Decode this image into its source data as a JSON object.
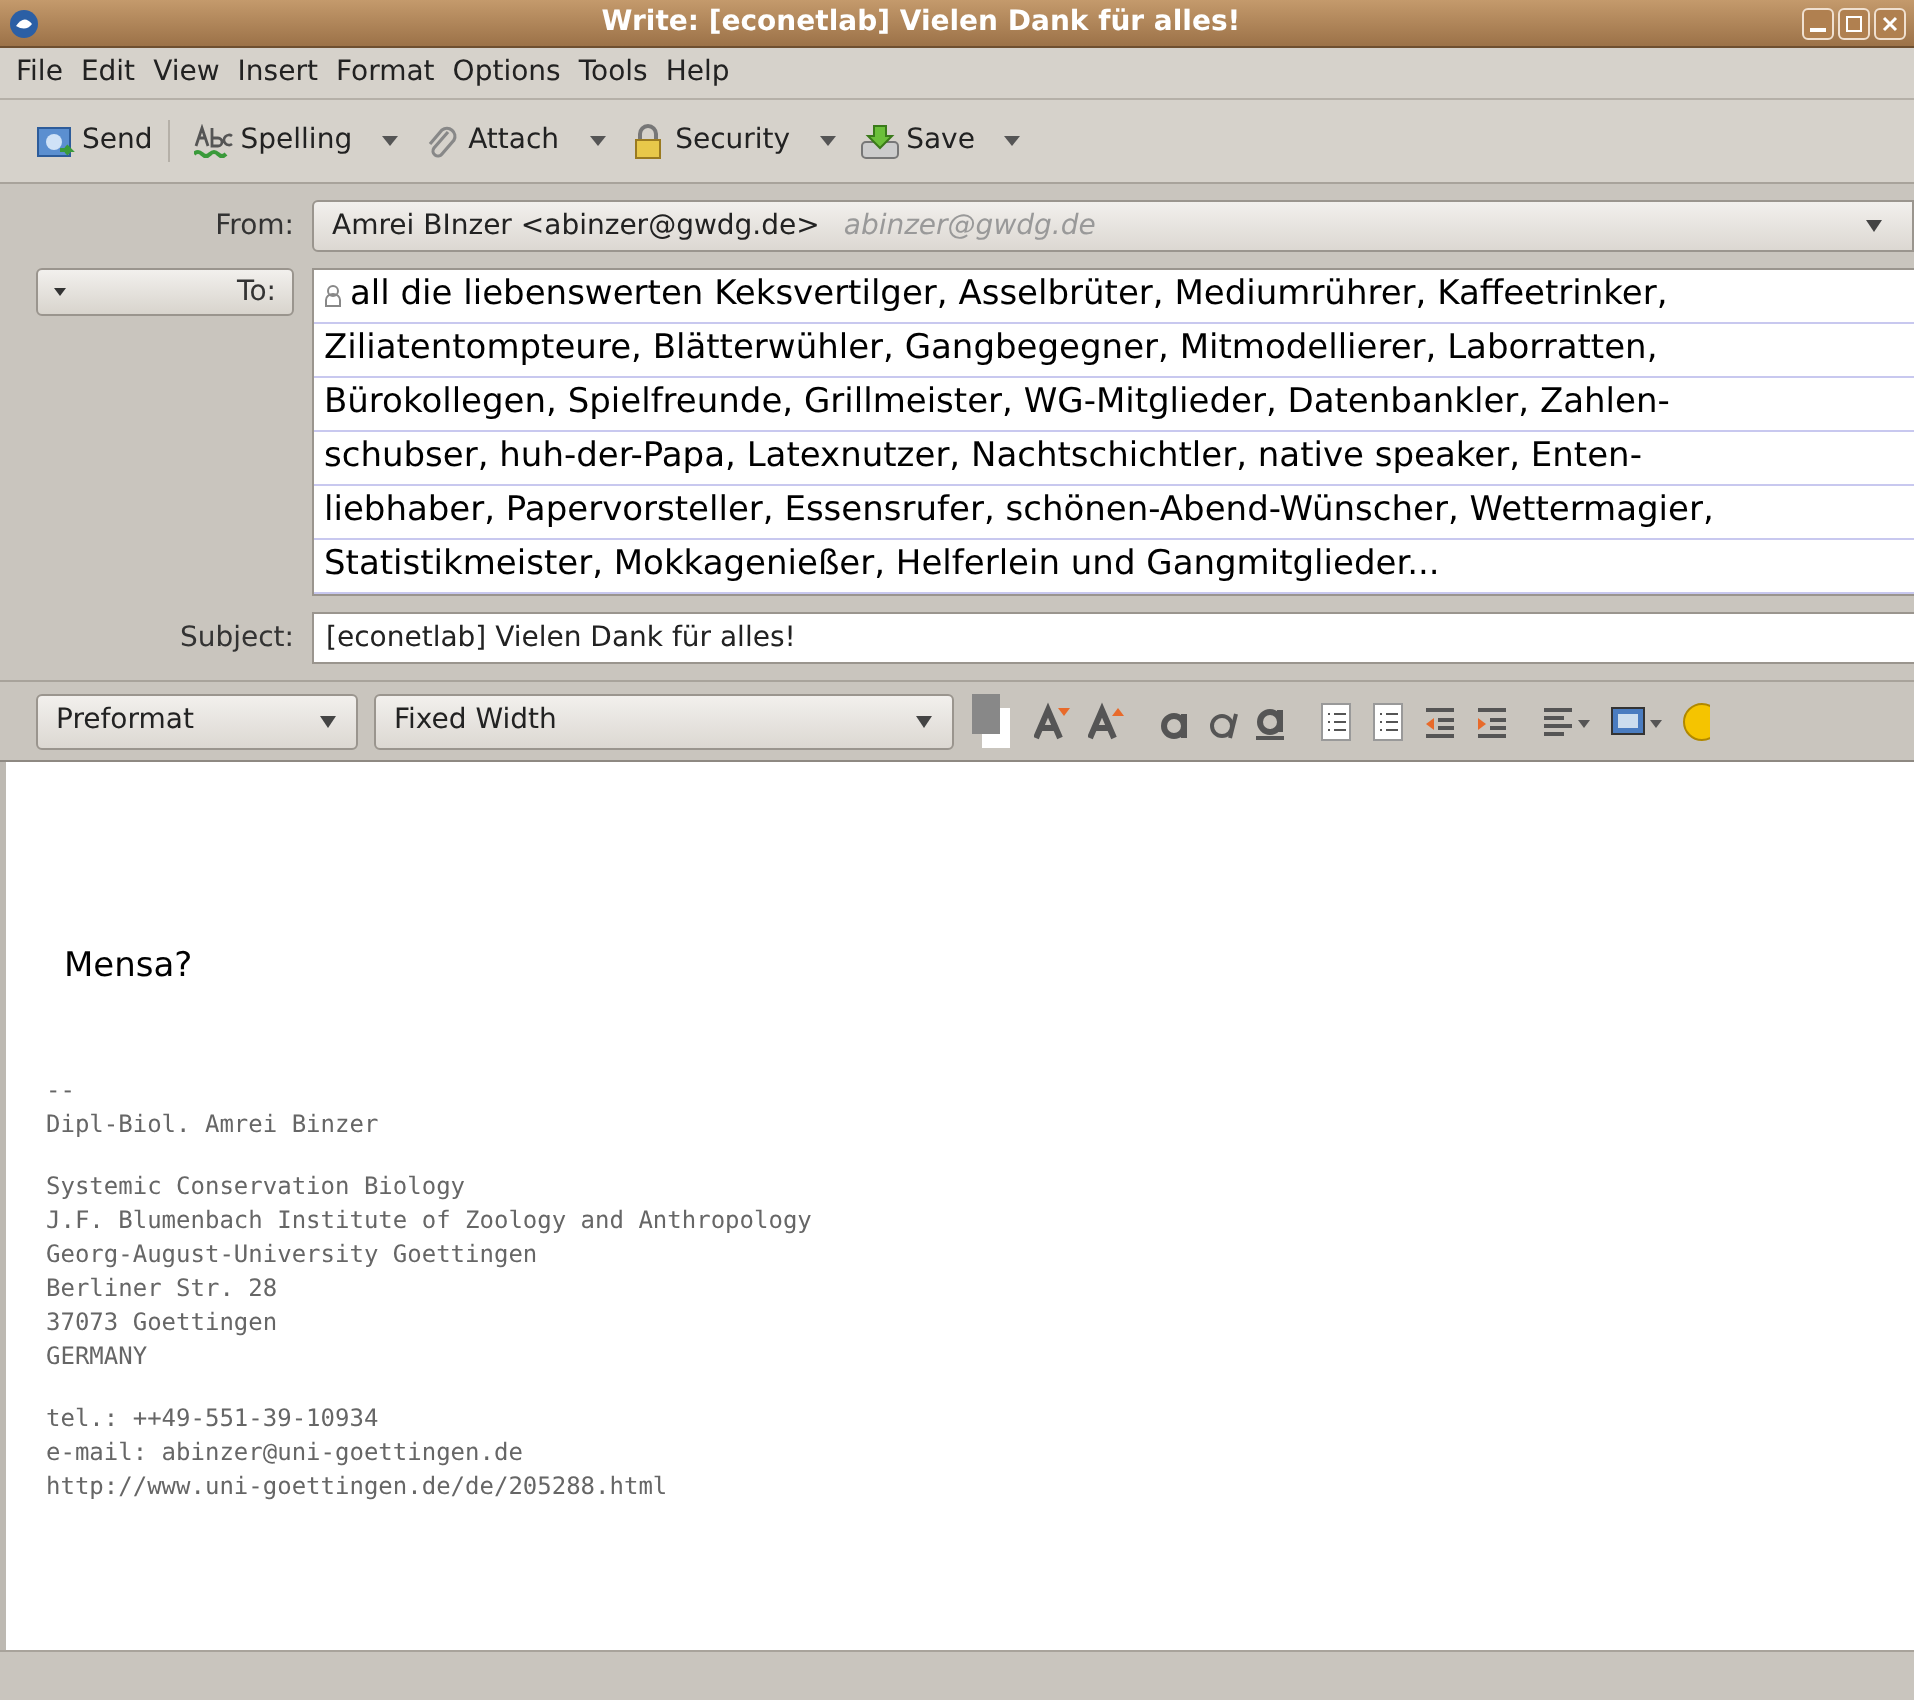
{
  "window": {
    "title": "Write: [econetlab] Vielen Dank für alles!"
  },
  "menu": [
    "File",
    "Edit",
    "View",
    "Insert",
    "Format",
    "Options",
    "Tools",
    "Help"
  ],
  "toolbar": [
    {
      "kind": "send",
      "label": "Send",
      "dropdown": false
    },
    {
      "kind": "spelling",
      "label": "Spelling",
      "dropdown": true
    },
    {
      "kind": "attach",
      "label": "Attach",
      "dropdown": true
    },
    {
      "kind": "security",
      "label": "Security",
      "dropdown": true
    },
    {
      "kind": "save",
      "label": "Save",
      "dropdown": true
    }
  ],
  "from": {
    "label": "From:",
    "name": "Amrei BInzer <abinzer@gwdg.de>",
    "account": "abinzer@gwdg.de"
  },
  "to": {
    "label": "To:",
    "lines": [
      "all die liebenswerten Keksvertilger, Asselbrüter, Mediumrührer, Kaffeetrinker,",
      "Ziliatentompteure, Blätterwühler, Gangbegegner, Mitmodellierer, Laborratten,",
      "Bürokollegen, Spielfreunde, Grillmeister, WG-Mitglieder, Datenbankler, Zahlen-",
      "schubser, huh-der-Papa, Latexnutzer, Nachtschichtler, native speaker, Enten-",
      "liebhaber, Papervorsteller, Essensrufer, schönen-Abend-Wünscher, Wettermagier,",
      "Statistikmeister, Mokkagenießer, Helferlein und Gangmitglieder..."
    ]
  },
  "subject": {
    "label": "Subject:",
    "value": "[econetlab] Vielen Dank für alles!"
  },
  "format_bar": {
    "paragraph": "Preformat",
    "font": "Fixed Width"
  },
  "body": {
    "text": "Mensa?",
    "signature": [
      [
        "--",
        "Dipl-Biol. Amrei Binzer"
      ],
      [
        "Systemic Conservation Biology",
        "J.F. Blumenbach Institute of Zoology and Anthropology",
        "Georg-August-University Goettingen",
        "Berliner Str. 28",
        "37073 Goettingen",
        "GERMANY"
      ],
      [
        "tel.: ++49-551-39-10934",
        "e-mail: abinzer@uni-goettingen.de",
        "http://www.uni-goettingen.de/de/205288.html"
      ]
    ]
  }
}
